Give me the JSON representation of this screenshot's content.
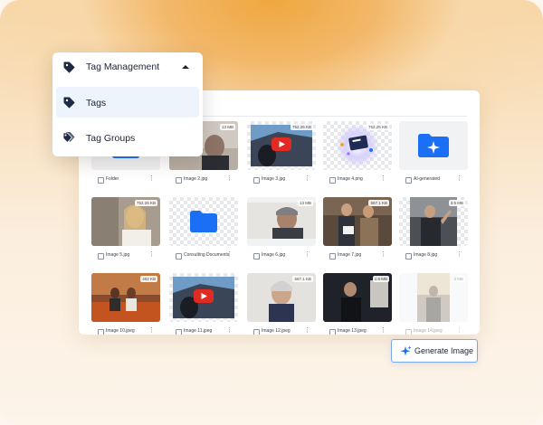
{
  "tag_menu": {
    "title": "Tag Management",
    "items": [
      {
        "label": "Tags",
        "active": true
      },
      {
        "label": "Tag Groups",
        "active": false
      }
    ]
  },
  "grid": {
    "rows": [
      [
        {
          "name": "Folder",
          "size": ""
        },
        {
          "name": "Image 2.jpg",
          "size": "13 MB"
        },
        {
          "name": "Image 3.jpg",
          "size": "752.25 KB"
        },
        {
          "name": "Image 4.png",
          "size": "752.25 KB"
        },
        {
          "name": "AI-generated",
          "size": ""
        }
      ],
      [
        {
          "name": "Image 5.jpg",
          "size": "752.25 KB"
        },
        {
          "name": "Consulting Documents",
          "size": ""
        },
        {
          "name": "Image 6.jpg",
          "size": "13 MB"
        },
        {
          "name": "Image 7.jpg",
          "size": "567.1 KB"
        },
        {
          "name": "Image 8.jpg",
          "size": "3.5 MB"
        }
      ],
      [
        {
          "name": "Image 10.jpeg",
          "size": "402 KB"
        },
        {
          "name": "Image 11.jpeg",
          "size": ""
        },
        {
          "name": "Image 12.jpeg",
          "size": "567.1 KB"
        },
        {
          "name": "Image 13.jpeg",
          "size": "1.5 MB"
        },
        {
          "name": "Image 14.jpeg",
          "size": "3 MB"
        }
      ]
    ]
  },
  "generate_button": {
    "label": "Generate Image"
  },
  "colors": {
    "accent": "#1b6ff5",
    "icon_dark": "#1d2a44",
    "active_item_bg": "#eef4fb",
    "button_border": "#7aa7ee",
    "youtube_red": "#e02a22"
  }
}
